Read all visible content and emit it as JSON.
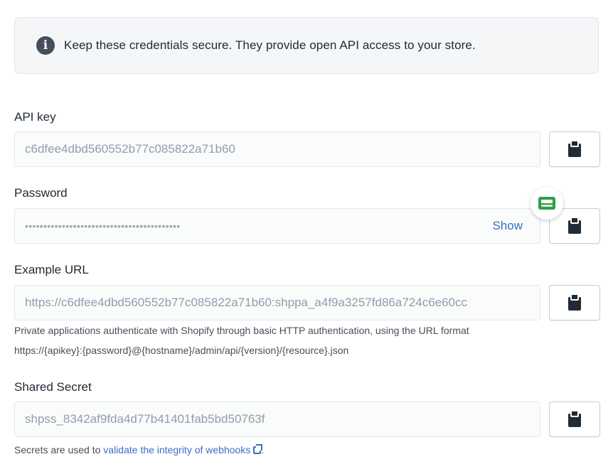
{
  "banner": {
    "icon": "info-icon",
    "icon_glyph": "i",
    "text": "Keep these credentials secure. They provide open API access to your store."
  },
  "api_key": {
    "label": "API key",
    "value": "c6dfee4dbd560552b77c085822a71b60",
    "copy_icon": "clipboard-icon"
  },
  "password": {
    "label": "Password",
    "value": "••••••••••••••••••••••••••••••••••••••••••",
    "show_label": "Show",
    "copy_icon": "clipboard-icon"
  },
  "example_url": {
    "label": "Example URL",
    "value": "https://c6dfee4dbd560552b77c085822a71b60:shppa_a4f9a3257fd86a724c6e60cc",
    "help_line1": "Private applications authenticate with Shopify through basic HTTP authentication, using the URL format",
    "help_line2": "https://{apikey}:{password}@{hostname}/admin/api/{version}/{resource}.json",
    "copy_icon": "clipboard-icon"
  },
  "shared_secret": {
    "label": "Shared Secret",
    "value": "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",
    "help_prefix": "Secrets are used to ",
    "help_link": "validate the integrity of webhooks",
    "help_suffix": ".",
    "copy_icon": "clipboard-icon"
  },
  "floating_badge": {
    "icon": "screen-capture-icon"
  },
  "colors": {
    "link": "#3b6ec4",
    "banner_bg": "#f4f6f8",
    "text": "#212b36",
    "badge_green": "#2e9e48"
  }
}
